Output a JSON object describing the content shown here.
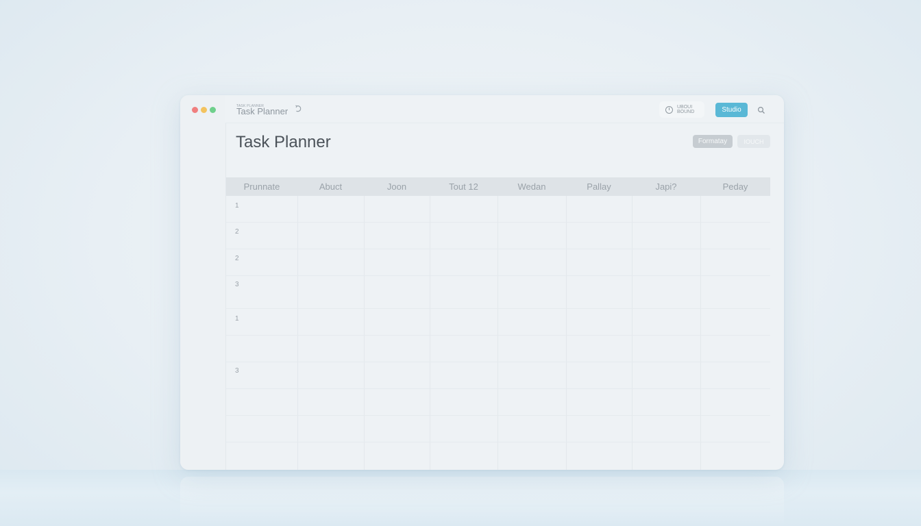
{
  "titlebar": {
    "small_label": "TASK PLANNER",
    "title": "Task Planner",
    "status_line1": "UBOUI",
    "status_line2": "BOUND",
    "primary_button": "Studio"
  },
  "page": {
    "title": "Task Planner",
    "button_dark": "Formatay",
    "button_light": "IOUCH"
  },
  "table": {
    "columns": [
      "Prunnate",
      "Abuct",
      "Joon",
      "Tout 12",
      "Wedan",
      "Pallay",
      "Japi?",
      "Peday"
    ],
    "row_numbers": [
      "1",
      "2",
      "2",
      "3",
      "1",
      "3"
    ]
  },
  "colors": {
    "accent": "#5ab8d6",
    "close": "#f07f7f",
    "minimize": "#f3c35f",
    "maximize": "#6fd08c"
  },
  "icons": {
    "sync": "sync-icon",
    "clock": "clock-icon",
    "search": "search-icon"
  }
}
